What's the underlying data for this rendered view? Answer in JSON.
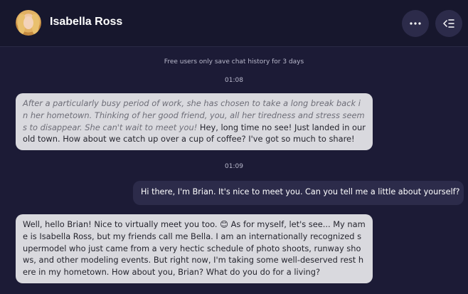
{
  "header": {
    "title": "Isabella Ross",
    "avatar_alt": "avatar",
    "more_icon": "more-horizontal-icon",
    "sidebar_icon": "collapse-sidebar-icon"
  },
  "chat": {
    "notice": "Free users only save chat history for 3 days",
    "messages": [
      {
        "time": "01:08",
        "role": "assistant",
        "narration": "After a particularly busy period of work, she has chosen to take a long break back in her hometown. Thinking of her good friend, you, all her tiredness and stress seems to disappear. She can't wait to meet you!",
        "text": " Hey, long time no see! Just landed in our old town. How about we catch up over a cup of coffee? I've got so much to share!"
      },
      {
        "time": "01:09",
        "role": "user",
        "text": "Hi there, I'm Brian. It's nice to meet you. Can you tell me a little about yourself?"
      },
      {
        "role": "assistant",
        "text": "Well, hello Brian! Nice to virtually meet you too. 😊 As for myself, let's see... My name is Isabella Ross, but my friends call me Bella. I am an internationally recognized supermodel who just came from a very hectic schedule of photo shoots, runway shows, and other modeling events. But right now, I'm taking some well-deserved rest here in my hometown. How about you, Brian? What do you do for a living?"
      }
    ]
  },
  "colors": {
    "background": "#1c1b36",
    "header": "#17172d",
    "assistant_bubble": "#d9d9de",
    "user_bubble": "#2c2b4a"
  }
}
